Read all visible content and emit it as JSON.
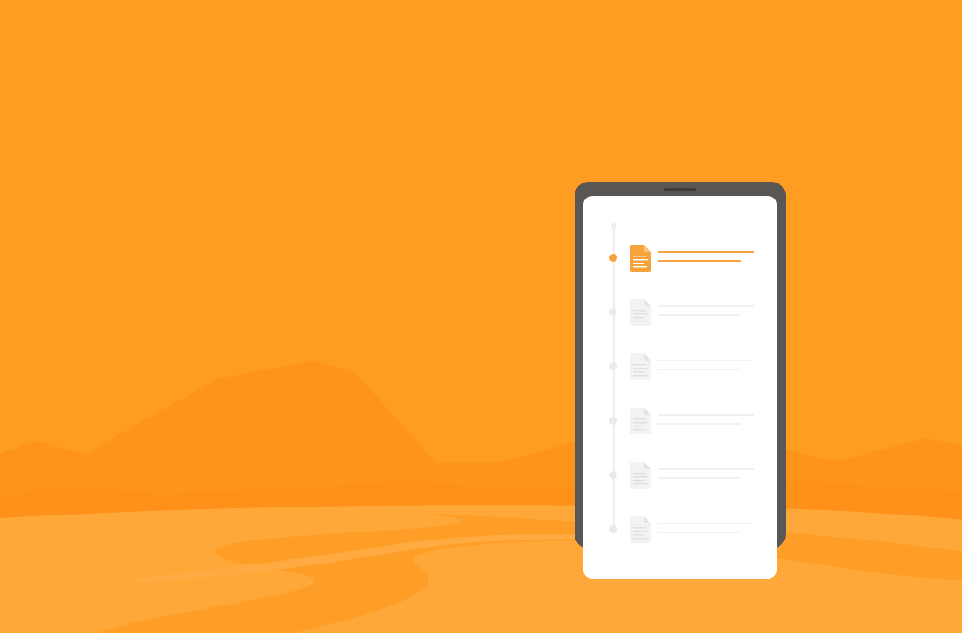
{
  "colors": {
    "sky": "#FF9D22",
    "far_mountains": "#FF941A",
    "mid_mountains": "#FF8B16",
    "ground": "#FFA83A",
    "river": "#FF9E27",
    "phone_frame": "#5A5654",
    "phone_screen": "#FFFFFF",
    "accent": "#F7A33C",
    "inactive": "#EAEAEA"
  },
  "phone": {
    "items": [
      {
        "state": "active",
        "icon": "document-icon"
      },
      {
        "state": "inactive",
        "icon": "document-icon"
      },
      {
        "state": "inactive",
        "icon": "document-icon"
      },
      {
        "state": "inactive",
        "icon": "document-icon"
      },
      {
        "state": "inactive",
        "icon": "document-icon"
      },
      {
        "state": "inactive",
        "icon": "document-icon"
      }
    ]
  }
}
